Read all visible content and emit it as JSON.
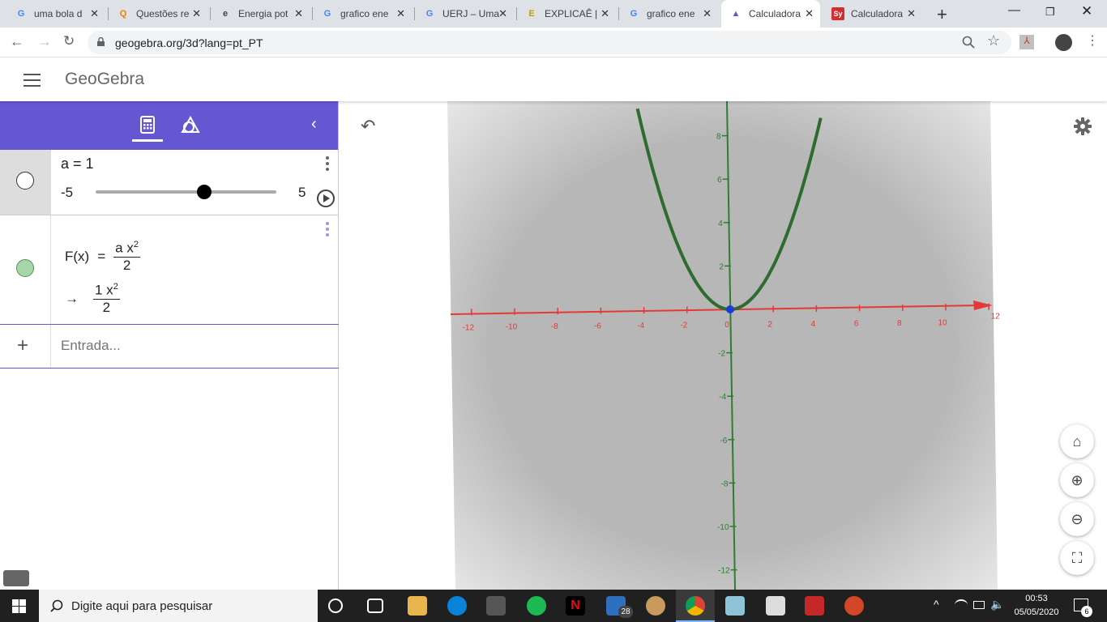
{
  "browser": {
    "tabs": [
      {
        "title": "uma bola d",
        "icon": "G",
        "color": "#4285f4"
      },
      {
        "title": "Questões re",
        "icon": "Q",
        "color": "#f57c00"
      },
      {
        "title": "Energia pot",
        "icon": "e",
        "color": "#37474f"
      },
      {
        "title": "grafico ene",
        "icon": "G",
        "color": "#4285f4"
      },
      {
        "title": "UERJ – Uma",
        "icon": "G",
        "color": "#4285f4"
      },
      {
        "title": "EXPLICAÊ |",
        "icon": "E",
        "color": "#c0a000"
      },
      {
        "title": "grafico ene",
        "icon": "G",
        "color": "#4285f4"
      },
      {
        "title": "Calculadora",
        "icon": "▲",
        "color": "#6557d2"
      },
      {
        "title": "Calculadora",
        "icon": "Sy",
        "color": "#d32f2f"
      }
    ],
    "url": "geogebra.org/3d?lang=pt_PT"
  },
  "app": {
    "name": "GeoGebra",
    "accent": "#6557d2"
  },
  "algebra": {
    "slider": {
      "label": "a = 1",
      "min": "-5",
      "max": "5",
      "value": 1,
      "position": 0.6
    },
    "function": {
      "lhs": "F(x)",
      "eq": "=",
      "num": "a x",
      "exp": "2",
      "den": "2",
      "arrow": "→",
      "res_num": "1 x",
      "res_exp": "2",
      "res_den": "2",
      "color": "#a5d6a7"
    },
    "input_placeholder": "Entrada..."
  },
  "graph": {
    "x_ticks": [
      "-12",
      "-10",
      "-8",
      "-6",
      "-4",
      "-2",
      "0",
      "2",
      "4",
      "6",
      "8",
      "10",
      "12"
    ],
    "y_ticks": [
      "8",
      "6",
      "4",
      "2",
      "-2",
      "-4",
      "-6",
      "-8",
      "-10",
      "-12"
    ],
    "x_axis_color": "#e53935",
    "y_axis_color": "#2e7d32",
    "curve_color": "#2e6b2e"
  },
  "taskbar": {
    "search": "Digite aqui para pesquisar",
    "time": "00:53",
    "date": "05/05/2020",
    "mail_badge": "28",
    "notif_badge": "6"
  }
}
